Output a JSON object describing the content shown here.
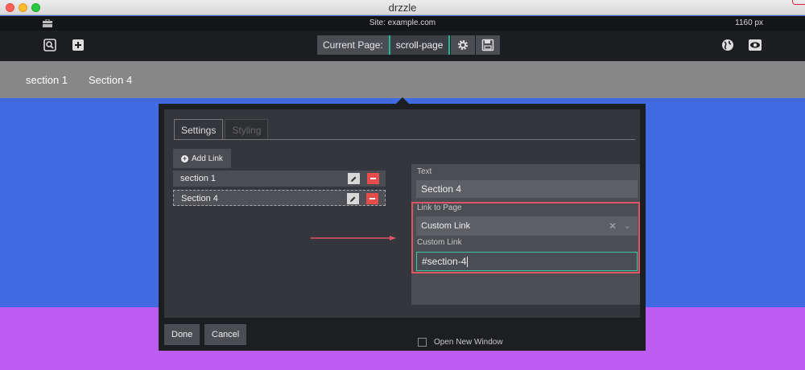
{
  "window": {
    "title": "drzzle"
  },
  "sitebar": {
    "site": "Site: example.com",
    "width": "1160 px"
  },
  "toolbar": {
    "left_icons": [
      "search-page-icon",
      "add-page-icon"
    ],
    "current_page_label": "Current Page:",
    "current_page_value": "scroll-page",
    "right_icons": [
      "globe-icon",
      "eye-icon"
    ]
  },
  "site_nav": {
    "links": [
      "section 1",
      "Section 4"
    ]
  },
  "modal": {
    "tabs": [
      {
        "label": "Settings",
        "active": true
      },
      {
        "label": "Styling",
        "active": false
      }
    ],
    "add_link_label": "Add Link",
    "links": [
      {
        "label": "section 1"
      },
      {
        "label": "Section 4",
        "selected": true
      }
    ],
    "form": {
      "text_label": "Text",
      "text_value": "Section 4",
      "link_to_page_label": "Link to Page",
      "link_to_page_value": "Custom Link",
      "custom_link_label": "Custom Link",
      "custom_link_value": "#section-4",
      "open_new_window_label": "Open New Window",
      "open_new_window_checked": false
    },
    "done_label": "Done",
    "cancel_label": "Cancel"
  },
  "colors": {
    "accent": "#1fb88f",
    "highlight_border": "#e05563",
    "remove": "#e74c4c",
    "page_blue": "#3f6ae0",
    "page_purple": "#bc5cf0"
  }
}
